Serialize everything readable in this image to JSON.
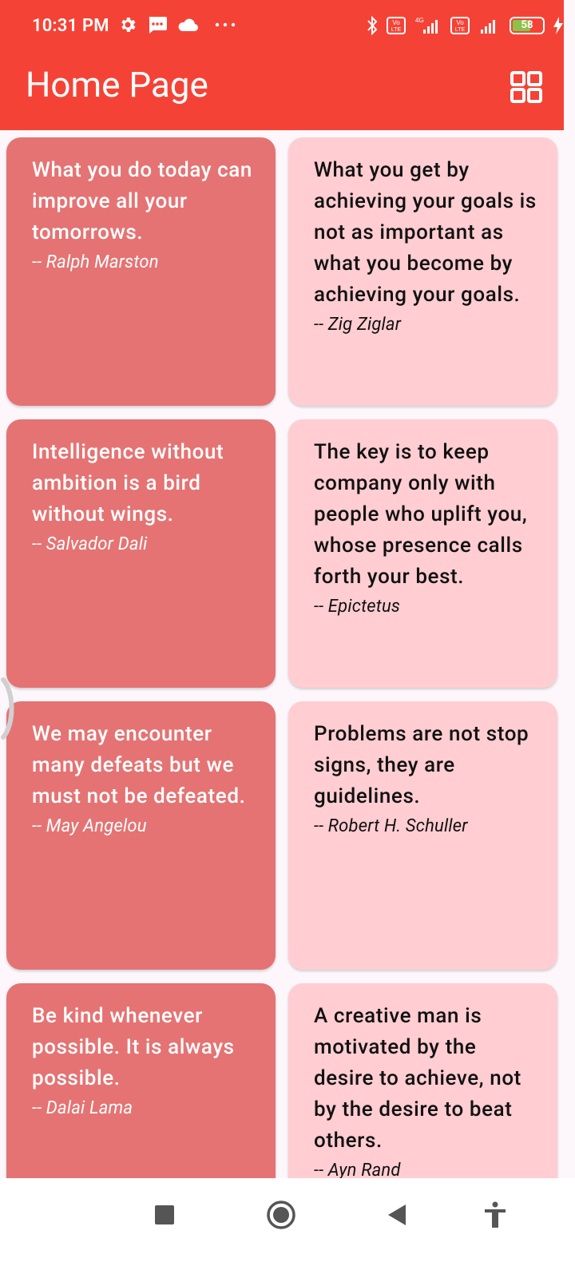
{
  "status_bar": {
    "time": "10:31 PM",
    "battery": "58",
    "icons_left": [
      "gear-icon",
      "message-icon",
      "cloud-icon",
      "more-icon"
    ],
    "icons_right": [
      "bluetooth-icon",
      "volte-icon",
      "signal-icon",
      "volte-icon",
      "signal-icon",
      "battery-icon",
      "charging-icon"
    ]
  },
  "app_bar": {
    "title": "Home Page",
    "action_icon": "grid-view-icon",
    "color": "#f44336"
  },
  "colors": {
    "card_dark": "#e57373",
    "card_light": "#ffcdd2",
    "background": "#fdf7fb"
  },
  "quotes": [
    {
      "text": "What you do today can improve all your tomorrows.",
      "author": "-- Ralph Marston"
    },
    {
      "text": "What you get by achieving your goals is not as important as what you become by achieving your goals.",
      "author": "-- Zig Ziglar"
    },
    {
      "text": "Intelligence without ambition is a bird without wings.",
      "author": "-- Salvador Dali"
    },
    {
      "text": "The key is to keep company only with people who uplift you, whose presence calls forth your best.",
      "author": "-- Epictetus"
    },
    {
      "text": "We may encounter many defeats but we must not be defeated.",
      "author": "-- May Angelou"
    },
    {
      "text": "Problems are not stop signs, they are guidelines.",
      "author": "-- Robert H. Schuller"
    },
    {
      "text": "Be kind whenever possible. It is always possible.",
      "author": "-- Dalai Lama"
    },
    {
      "text": "A creative man is motivated by the desire to achieve, not by the desire to beat others.",
      "author": "-- Ayn Rand"
    }
  ],
  "nav_bar": [
    "recents-icon",
    "home-icon",
    "back-icon",
    "accessibility-icon"
  ]
}
